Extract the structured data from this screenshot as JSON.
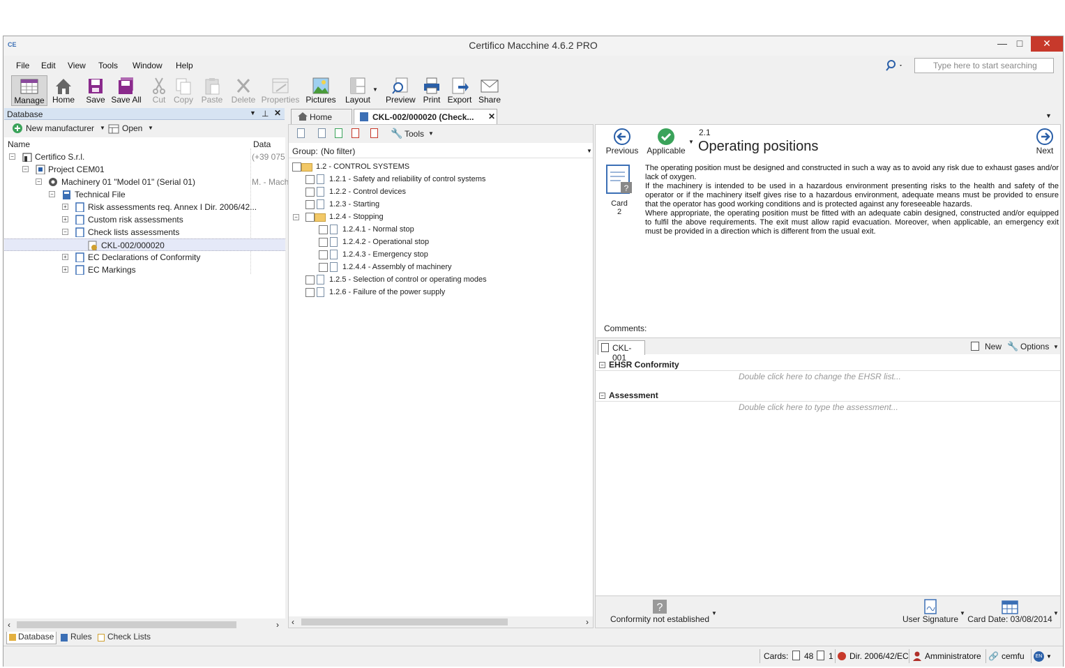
{
  "window": {
    "title": "Certifico Macchine 4.6.2 PRO",
    "min": "—",
    "max": "□",
    "close": "✕"
  },
  "menu": [
    "File",
    "Edit",
    "View",
    "Tools",
    "Window",
    "Help"
  ],
  "search": {
    "placeholder": "Type here to start searching"
  },
  "toolbar": {
    "manage": "Manage",
    "home": "Home",
    "save": "Save",
    "save_all": "Save All",
    "cut": "Cut",
    "copy": "Copy",
    "paste": "Paste",
    "delete": "Delete",
    "properties": "Properties",
    "pictures": "Pictures",
    "layout": "Layout",
    "preview": "Preview",
    "print": "Print",
    "export": "Export",
    "share": "Share"
  },
  "left": {
    "header": "Database",
    "new_manufacturer": "New manufacturer",
    "open": "Open",
    "col_name": "Name",
    "col_data": "Data",
    "tree": [
      {
        "label": "Certifico S.r.l.",
        "data": "(+39 075"
      },
      {
        "label": "Project CEM01",
        "data": ""
      },
      {
        "label": "Machinery 01 \"Model 01\" (Serial 01)",
        "data": "M. - Mach"
      },
      {
        "label": "Technical File",
        "data": ""
      },
      {
        "label": "Risk assessments req. Annex I Dir. 2006/42...",
        "data": ""
      },
      {
        "label": "Custom risk assessments",
        "data": ""
      },
      {
        "label": "Check lists assessments",
        "data": ""
      },
      {
        "label": "CKL-002/000020",
        "data": ""
      },
      {
        "label": "EC Declarations of Conformity",
        "data": ""
      },
      {
        "label": "EC Markings",
        "data": ""
      }
    ],
    "bottom_tabs": [
      "Database",
      "Rules",
      "Check Lists"
    ]
  },
  "tabs": {
    "home": "Home",
    "doc": "CKL-002/000020 (Check..."
  },
  "middle": {
    "tools": "Tools",
    "group_label": "Group:",
    "group_value": "(No filter)",
    "items": [
      "1.2 - CONTROL SYSTEMS",
      "1.2.1 - Safety and reliability of control systems",
      "1.2.2 - Control devices",
      "1.2.3 - Starting",
      "1.2.4 - Stopping",
      "1.2.4.1 - Normal stop",
      "1.2.4.2 - Operational stop",
      "1.2.4.3 - Emergency stop",
      "1.2.4.4 - Assembly of machinery",
      "1.2.5 - Selection of control or operating modes",
      "1.2.6 - Failure of the power supply"
    ]
  },
  "right": {
    "previous": "Previous",
    "applicable": "Applicable",
    "next": "Next",
    "number": "2.1",
    "heading": "Operating positions",
    "card_label": "Card",
    "card_num": "2",
    "para1": "The operating position must be designed and constructed in such a way as to avoid any risk due to exhaust gases and/or lack of oxygen.",
    "para2": "If the machinery is intended to be used in a hazardous environment presenting risks to the health and safety of the operator or if the machinery itself gives rise to a hazardous environment, adequate means must be provided to ensure that the operator has good working conditions and is protected against any foreseeable hazards.",
    "para3": "Where appropriate, the operating position must be fitted with an adequate cabin designed, constructed and/or equipped to fulfil the above requirements. The exit must allow rapid evacuation. Moreover, when applicable, an emergency exit must be provided in a direction which is different from the usual exit.",
    "comments": "Comments:",
    "ckl_tab": "CKL-001",
    "new": "New",
    "options": "Options",
    "ehsr": "EHSR Conformity",
    "ehsr_hint": "Double click here to change the EHSR list...",
    "assessment": "Assessment",
    "assessment_hint": "Double click here to type the assessment...",
    "conformity": "Conformity not established",
    "user_signature": "User Signature",
    "card_date": "Card Date: 03/08/2014"
  },
  "status": {
    "cards_label": "Cards:",
    "cards_total": "48",
    "cards_sel": "1",
    "directive": "Dir. 2006/42/EC",
    "user": "Amministratore",
    "db": "cemfu",
    "lang": "EN"
  }
}
